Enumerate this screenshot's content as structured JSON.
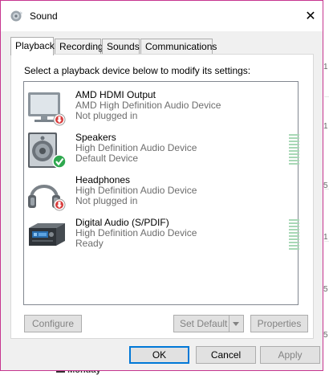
{
  "window": {
    "title": "Sound",
    "close_glyph": "✕"
  },
  "tabs": [
    {
      "label": "Playback",
      "active": true
    },
    {
      "label": "Recording",
      "active": false
    },
    {
      "label": "Sounds",
      "active": false
    },
    {
      "label": "Communications",
      "active": false
    }
  ],
  "playback": {
    "instructions": "Select a playback device below to modify its settings:",
    "devices": [
      {
        "name": "AMD HDMI Output",
        "description": "AMD High Definition Audio Device",
        "status": "Not plugged in",
        "icon": "monitor-icon",
        "badge": "unplugged-badge-icon",
        "level_meter": false
      },
      {
        "name": "Speakers",
        "description": "High Definition Audio Device",
        "status": "Default Device",
        "icon": "speaker-icon",
        "badge": "default-check-icon",
        "level_meter": true
      },
      {
        "name": "Headphones",
        "description": "High Definition Audio Device",
        "status": "Not plugged in",
        "icon": "headphones-icon",
        "badge": "unplugged-badge-icon",
        "level_meter": false
      },
      {
        "name": "Digital Audio (S/PDIF)",
        "description": "High Definition Audio Device",
        "status": "Ready",
        "icon": "digital-receiver-icon",
        "badge": "",
        "level_meter": true
      }
    ],
    "buttons": {
      "configure": "Configure",
      "set_default": "Set Default",
      "properties": "Properties"
    }
  },
  "footer": {
    "ok": "OK",
    "cancel": "Cancel",
    "apply": "Apply"
  },
  "background": {
    "monday": "Monday",
    "edge_chars": [
      "1",
      "1",
      "5",
      "1",
      "5",
      "5"
    ]
  },
  "colors": {
    "accent": "#0078d7",
    "window_border": "#c6358f",
    "default_check": "#2fa84f",
    "unplugged_badge": "#d83b3b",
    "level_meter": "#a8d8b6"
  }
}
